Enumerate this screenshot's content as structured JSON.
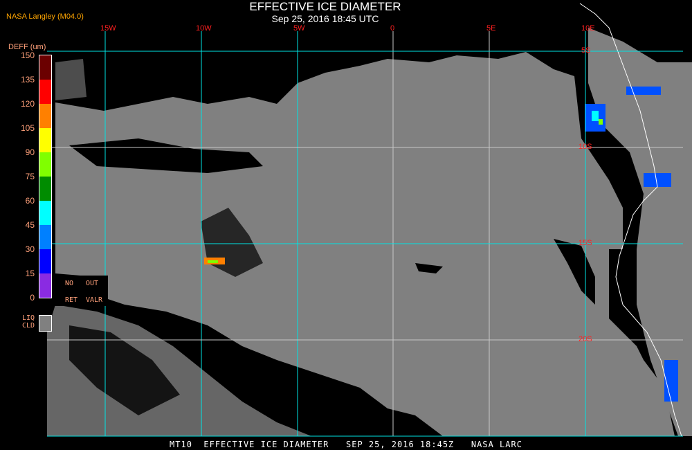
{
  "header": {
    "title": "EFFECTIVE ICE DIAMETER",
    "subtitle": "Sep 25, 2016 18:45 UTC",
    "agency": "NASA Langley (M04.0)"
  },
  "legend": {
    "label": "DEFF (um)",
    "ticks": [
      "150",
      "135",
      "120",
      "105",
      "90",
      "75",
      "60",
      "45",
      "30",
      "15",
      "0"
    ],
    "colors": [
      "#6b0000",
      "#ff0000",
      "#ff8000",
      "#ffff00",
      "#80ff00",
      "#008c00",
      "#00ffff",
      "#0080ff",
      "#0000ff",
      "#8a2be2"
    ],
    "no_ret": [
      "NO",
      "RET"
    ],
    "out_valr": [
      "OUT",
      "VALR"
    ],
    "liq_cld": [
      "LIQ",
      "CLD"
    ],
    "liq_color": "#808080"
  },
  "map": {
    "longitudes": [
      "15W",
      "10W",
      "5W",
      "0",
      "5E",
      "10E"
    ],
    "latitudes": [
      "5S",
      "10S",
      "15S",
      "20S"
    ],
    "grid_cyan": "#00e5e5",
    "grid_white": "#c8c8c8",
    "cloud_gray": "#808080"
  },
  "footer": "MT10  EFFECTIVE ICE DIAMETER   SEP 25, 2016 18:45Z   NASA LARC"
}
